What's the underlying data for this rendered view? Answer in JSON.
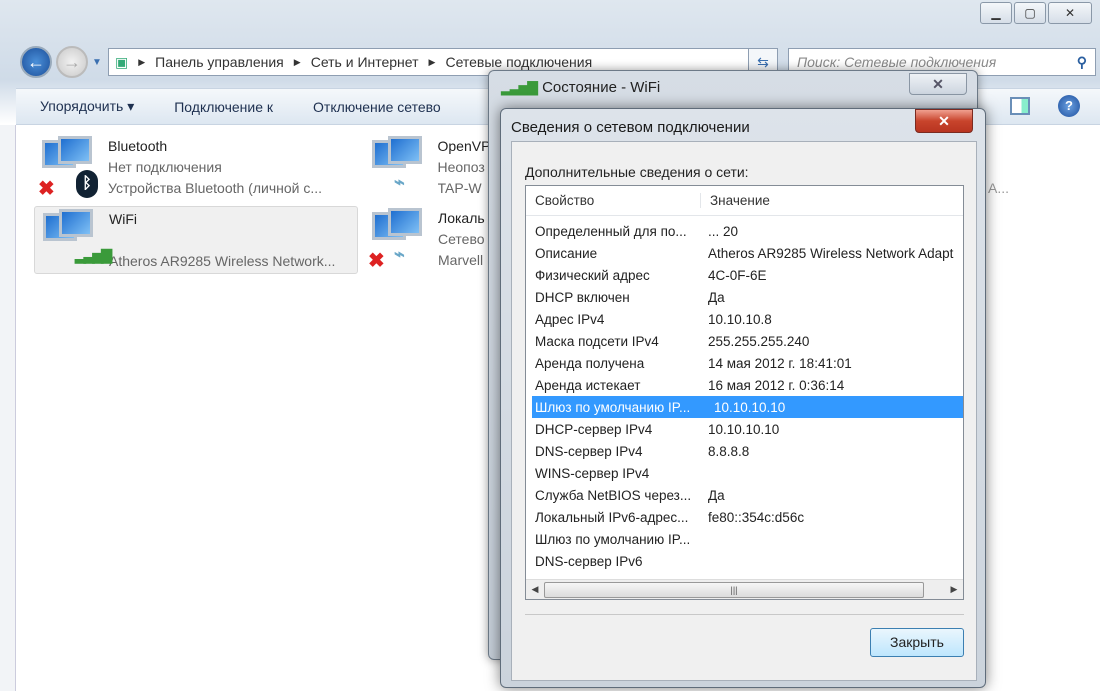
{
  "explorer": {
    "breadcrumb": [
      "Панель управления",
      "Сеть и Интернет",
      "Сетевые подключения"
    ],
    "search_placeholder": "Поиск: Сетевые подключения",
    "toolbar": {
      "organize": "Упорядочить ▾",
      "connect": "Подключение к",
      "disconnect": "Отключение сетево"
    },
    "connections": [
      {
        "name": "Bluetooth",
        "status": "Нет подключения",
        "device": "Устройства Bluetooth (личной с..."
      },
      {
        "name": "WiFi",
        "status": "",
        "device": "Atheros AR9285 Wireless Network..."
      },
      {
        "name": "OpenVP",
        "status": "Неопоз",
        "device": "TAP-W"
      },
      {
        "name": "Локаль",
        "status": "Сетево",
        "device": "Marvell"
      }
    ],
    "side_fragment": "А..."
  },
  "status_dialog": {
    "title": "Состояние - WiFi"
  },
  "details_dialog": {
    "title": "Сведения о сетевом подключении",
    "label": "Дополнительные сведения о сети:",
    "columns": [
      "Свойство",
      "Значение"
    ],
    "rows": [
      {
        "prop": "Определенный для по...",
        "value": "... 20"
      },
      {
        "prop": "Описание",
        "value": "Atheros AR9285 Wireless Network Adapt"
      },
      {
        "prop": "Физический адрес",
        "value": "4C-0F-6E"
      },
      {
        "prop": "DHCP включен",
        "value": "Да"
      },
      {
        "prop": "Адрес IPv4",
        "value": "10.10.10.8"
      },
      {
        "prop": "Маска подсети IPv4",
        "value": "255.255.255.240"
      },
      {
        "prop": "Аренда получена",
        "value": "14 мая 2012 г. 18:41:01"
      },
      {
        "prop": "Аренда истекает",
        "value": "16 мая 2012 г. 0:36:14"
      },
      {
        "prop": "Шлюз по умолчанию IP...",
        "value": "10.10.10.10"
      },
      {
        "prop": "DHCP-сервер IPv4",
        "value": "10.10.10.10"
      },
      {
        "prop": "DNS-сервер IPv4",
        "value": "8.8.8.8"
      },
      {
        "prop": "WINS-сервер IPv4",
        "value": ""
      },
      {
        "prop": "Служба NetBIOS через...",
        "value": "Да"
      },
      {
        "prop": "Локальный IPv6-адрес...",
        "value": "fe80::354c:d56c"
      },
      {
        "prop": "Шлюз по умолчанию IP...",
        "value": ""
      },
      {
        "prop": "DNS-сервер IPv6",
        "value": ""
      }
    ],
    "selected_row": 8,
    "close_label": "Закрыть"
  }
}
